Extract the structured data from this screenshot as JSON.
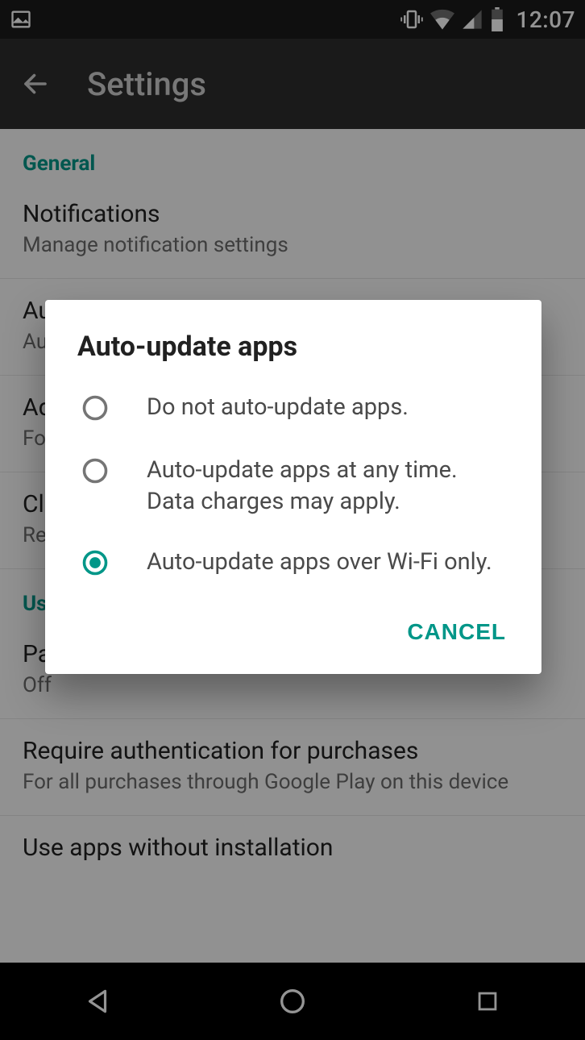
{
  "colors": {
    "accent": "#009688"
  },
  "status_bar": {
    "time": "12:07"
  },
  "header": {
    "title": "Settings"
  },
  "sections": {
    "general_label": "General",
    "user_controls_label": "User controls"
  },
  "rows": {
    "notifications": {
      "title": "Notifications",
      "sub": "Manage notification settings"
    },
    "auto_update": {
      "title": "Auto-update apps",
      "sub": "Auto-update apps over Wi-Fi only."
    },
    "add_icon": {
      "title": "Add icon to Home screen",
      "sub": "For new apps"
    },
    "clear_history": {
      "title": "Clear local search history",
      "sub": "Remove searches you have performed from this device"
    },
    "parental": {
      "title": "Parental controls",
      "sub": "Off"
    },
    "auth": {
      "title": "Require authentication for purchases",
      "sub": "For all purchases through Google Play on this device"
    },
    "instant": {
      "title": "Use apps without installation"
    }
  },
  "dialog": {
    "title": "Auto-update apps",
    "options": [
      {
        "label": "Do not auto-update apps.",
        "selected": false
      },
      {
        "label": "Auto-update apps at any time. Data charges may apply.",
        "selected": false
      },
      {
        "label": "Auto-update apps over Wi-Fi only.",
        "selected": true
      }
    ],
    "cancel_label": "CANCEL"
  }
}
